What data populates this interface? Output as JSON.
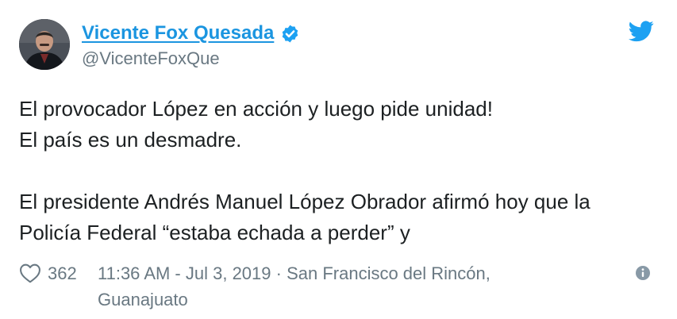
{
  "author": {
    "name": "Vicente Fox Quesada",
    "handle": "@VicenteFoxQue",
    "verified": true,
    "avatar_icon": "person-portrait-avatar"
  },
  "tweet": {
    "lines": [
      "El provocador López en acción y luego pide unidad!",
      "El país es un desmadre.",
      "",
      "El presidente Andrés Manuel López Obrador afirmó hoy que la",
      "Policía Federal “estaba echada a perder” y"
    ]
  },
  "footer": {
    "like_count": "362",
    "timestamp": "11:36 AM - Jul 3, 2019",
    "separator": " · ",
    "location_line1": "San Francisco del Rincón,",
    "location_line2": "Guanajuato"
  },
  "icons": {
    "brand": "twitter-bird-icon",
    "verified": "verified-badge-icon",
    "like": "heart-icon",
    "info": "info-icon"
  },
  "colors": {
    "link_blue": "#1b95e0",
    "twitter_blue": "#1da1f2",
    "muted_gray": "#697882",
    "text": "#1c2022"
  }
}
